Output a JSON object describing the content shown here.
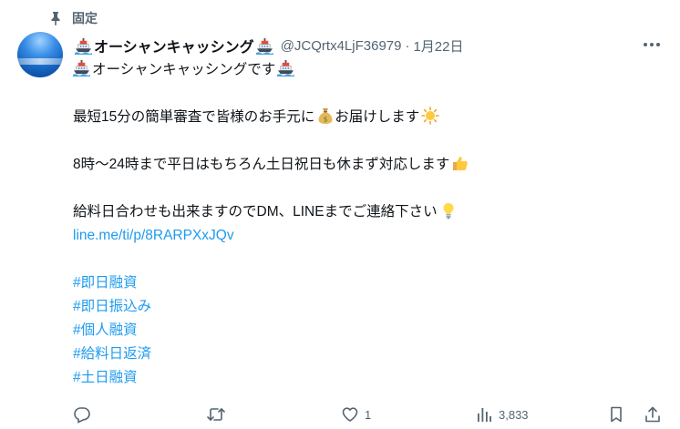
{
  "pinned": {
    "label": "固定",
    "icon": "pin-icon"
  },
  "author": {
    "name": "オーシャンキャッシング",
    "handle": "@JCQrtx4LjF36979",
    "separator": "·",
    "date": "1月22日"
  },
  "tweet": {
    "line1": "オーシャンキャッシングです",
    "line2": "最短15分の簡単審査で皆様のお手元に",
    "line2_suffix": "お届けします",
    "line3": "8時〜24時まで平日はもちろん土日祝日も休まず対応します",
    "line4": "給料日合わせも出来ますのでDM、LINEまでご連絡下さい",
    "link": "line.me/ti/p/8RARPXxJQv",
    "hashtags": [
      "#即日融資",
      "#即日振込み",
      "#個人融資",
      "#給料日返済",
      "#土日融資"
    ]
  },
  "actions": {
    "reply_count": "",
    "retweet_count": "",
    "like_count": "1",
    "views_count": "3,833"
  },
  "colors": {
    "accent": "#1d9bf0",
    "secondary_text": "#536471"
  }
}
